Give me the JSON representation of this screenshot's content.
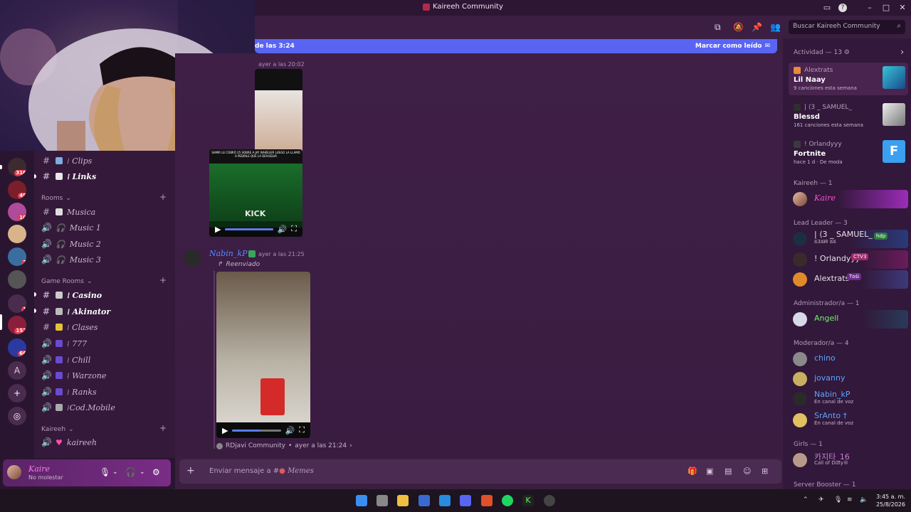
{
  "window": {
    "title": "Kaireeh Community"
  },
  "header": {
    "search_placeholder": "Buscar Kaireeh Community"
  },
  "newbar": {
    "left_text": "de las 3:24",
    "right_text": "Marcar como leído"
  },
  "servers": [
    {
      "badge": "316"
    },
    {
      "badge": "49"
    },
    {
      "badge": "10"
    },
    {
      "badge": ""
    },
    {
      "badge": "7"
    },
    {
      "badge": ""
    },
    {
      "badge": "1"
    },
    {
      "badge": "152"
    },
    {
      "badge": "66"
    }
  ],
  "server_letter": "A",
  "channels": {
    "top": [
      {
        "label": "⁞ Clips",
        "type": "text"
      },
      {
        "label": "⁞ Links",
        "type": "text"
      }
    ],
    "rooms_title": "Rooms",
    "rooms": [
      {
        "label": "Musica",
        "type": "text"
      },
      {
        "label": "Music 1",
        "type": "voice"
      },
      {
        "label": "Music 2",
        "type": "voice"
      },
      {
        "label": "Music 3",
        "type": "voice"
      }
    ],
    "game_title": "Game Rooms",
    "game": [
      {
        "label": "⁞ Casino",
        "type": "text"
      },
      {
        "label": "⁞ Akinator",
        "type": "text"
      },
      {
        "label": "⁞ Clases",
        "type": "text"
      },
      {
        "label": "⁞ 777",
        "type": "voice"
      },
      {
        "label": "⁞ Chill",
        "type": "voice"
      },
      {
        "label": "⁞ Warzone",
        "type": "voice"
      },
      {
        "label": "⁞ Ranks",
        "type": "voice"
      },
      {
        "label": "⁞Cod.Mobile",
        "type": "voice"
      }
    ],
    "kaireeh_title": "Kaireeh",
    "kaireeh": [
      {
        "label": "kaireeh",
        "type": "voice"
      }
    ]
  },
  "user": {
    "name": "Kaire",
    "status": "No molestar"
  },
  "chat": {
    "msg1": {
      "timestamp": "ayer a las 20:02",
      "caption": "SAMIR LE COBRÓ 25 SOBRE A JAY WHEELER LUEGO LA LLAMÓ A PEDIRLE QUE LA DEVUELVA",
      "watermark": "KICK"
    },
    "msg2": {
      "author": "Nabin_kP",
      "timestamp": "ayer a las 21:25",
      "forwarded": "Reenviado"
    },
    "msg3": {
      "source": "RDjavi Community",
      "timestamp": "ayer a las 21:24"
    }
  },
  "composer": {
    "placeholder_prefix": "Enviar mensaje a #",
    "placeholder_channel": "Memes"
  },
  "members": {
    "activity_title": "Actividad — 13",
    "activities": [
      {
        "who": "Alextrats",
        "what": "Lil Naay",
        "sub": "9 canciones esta semana"
      },
      {
        "who": "| ⟨3 _ SAMUEL_",
        "what": "Blessd",
        "sub": "161 canciones esta semana"
      },
      {
        "who": "! Orlandyyy",
        "what": "Fortnite",
        "sub": "hace 1 d · De moda"
      }
    ],
    "sections": [
      {
        "title": "Kaireeh — 1",
        "items": [
          {
            "name": "Kaire",
            "color": "#ff4fd8"
          }
        ]
      },
      {
        "title": "Lead Leader — 3",
        "items": [
          {
            "name": "| ⟨3 _ SAMUEL_",
            "color": "#e9e0ea",
            "tag": "hdp",
            "status": "ᘜ3ᘜᘘ ᘜᘜ"
          },
          {
            "name": "! Orlandyyy",
            "color": "#e9e0ea",
            "tag": "CTV3"
          },
          {
            "name": "Alextrats",
            "color": "#e9e0ea",
            "tag": "Tᴅśi"
          }
        ]
      },
      {
        "title": "Administrador/a — 1",
        "items": [
          {
            "name": "Angell",
            "color": "#6ef06e"
          }
        ]
      },
      {
        "title": "Moderador/a — 4",
        "items": [
          {
            "name": "chino",
            "color": "#5aa6ff"
          },
          {
            "name": "jovanny",
            "color": "#5aa6ff"
          },
          {
            "name": "Nabin_kP",
            "color": "#5aa6ff",
            "status": "En canal de voz"
          },
          {
            "name": "SrAnto †",
            "color": "#5aa6ff",
            "status": "En canal de voz"
          }
        ]
      },
      {
        "title": "Girls — 1",
        "items": [
          {
            "name": "카지타_16",
            "color": "#c77ed6",
            "status": "Call of Duty®"
          }
        ]
      },
      {
        "title": "Server Booster — 1",
        "items": []
      }
    ]
  },
  "taskbar": {
    "time": "3:45 a. m.",
    "date": "25/8/2026"
  }
}
